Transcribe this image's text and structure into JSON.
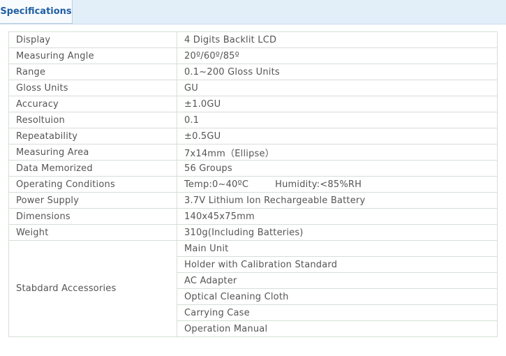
{
  "tab": {
    "label": "Specifications"
  },
  "specs": [
    {
      "label": "Display",
      "value": "4 Digits Backlit LCD"
    },
    {
      "label": "Measuring Angle",
      "value": "20º/60º/85º"
    },
    {
      "label": "Range",
      "value": "0.1~200 Gloss Units"
    },
    {
      "label": "Gloss Units",
      "value": "GU"
    },
    {
      "label": "Accuracy",
      "value": "±1.0GU"
    },
    {
      "label": "Resoltuion",
      "value": "0.1"
    },
    {
      "label": "Repeatability",
      "value": "±0.5GU"
    },
    {
      "label": "Measuring Area",
      "value": "7x14mm（Ellipse）"
    },
    {
      "label": "Data Memorized",
      "value": "56 Groups"
    },
    {
      "label": "Operating Conditions",
      "value": "Temp:0~40ºC",
      "value2": "Humidity:<85%RH"
    },
    {
      "label": "Power Supply",
      "value": "3.7V Lithium Ion Rechargeable Battery"
    },
    {
      "label": "Dimensions",
      "value": "140x45x75mm"
    },
    {
      "label": "Weight",
      "value": "310g(Including Batteries)"
    }
  ],
  "accessories": {
    "label": "Stabdard Accessories",
    "items": [
      "Main Unit",
      "Holder with Calibration Standard",
      "AC Adapter",
      "Optical Cleaning Cloth",
      "Carrying Case",
      "Operation Manual"
    ]
  }
}
